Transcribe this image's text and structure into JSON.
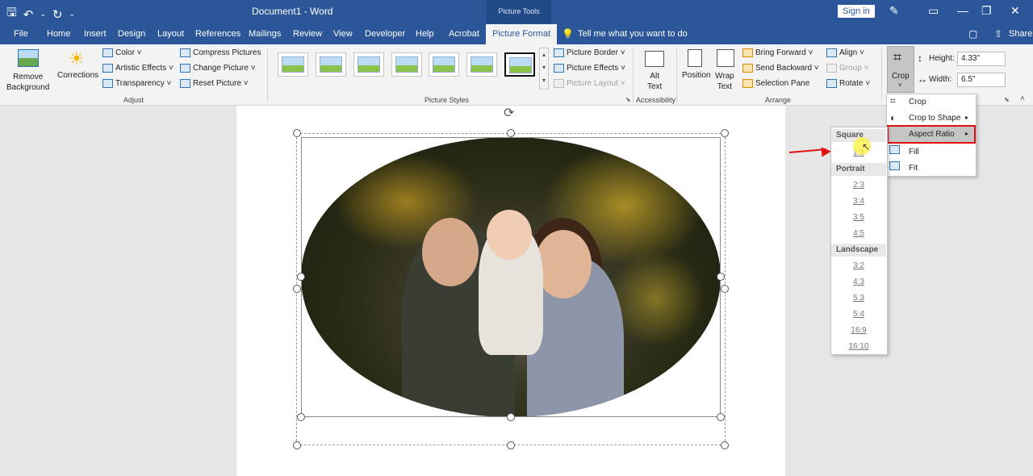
{
  "titlebar": {
    "doc_title": "Document1  -  Word",
    "context_label": "Picture Tools",
    "signin_label": "Sign in"
  },
  "tabs": [
    "File",
    "Home",
    "Insert",
    "Design",
    "Layout",
    "References",
    "Mailings",
    "Review",
    "View",
    "Developer",
    "Help",
    "Acrobat",
    "Picture Format"
  ],
  "tellme": "Tell me what you want to do",
  "share_label": "Share",
  "ribbon": {
    "remove_background": "Remove\nBackground",
    "corrections": "Corrections",
    "color": "Color",
    "artistic_effects": "Artistic Effects",
    "transparency": "Transparency",
    "compress_pictures": "Compress Pictures",
    "change_picture": "Change Picture",
    "reset_picture": "Reset Picture",
    "adjust_label": "Adjust",
    "picture_styles_label": "Picture Styles",
    "picture_border": "Picture Border",
    "picture_effects": "Picture Effects",
    "picture_layout": "Picture Layout",
    "alt_text": "Alt\nText",
    "accessibility_label": "Accessibility",
    "position": "Position",
    "wrap_text": "Wrap\nText",
    "bring_forward": "Bring Forward",
    "send_backward": "Send Backward",
    "selection_pane": "Selection Pane",
    "align": "Align",
    "group": "Group",
    "rotate": "Rotate",
    "arrange_label": "Arrange",
    "crop": "Crop",
    "height_label": "Height:",
    "height_value": "4.33\"",
    "width_label": "Width:",
    "width_value": "6.5\""
  },
  "crop_menu": {
    "items": [
      "Crop",
      "Crop to Shape",
      "Aspect Ratio",
      "Fill",
      "Fit"
    ]
  },
  "aspect_menu": {
    "square_header": "Square",
    "square": [
      "1:1"
    ],
    "portrait_header": "Portrait",
    "portrait": [
      "2:3",
      "3:4",
      "3:5",
      "4:5"
    ],
    "landscape_header": "Landscape",
    "landscape": [
      "3:2",
      "4:3",
      "5:3",
      "5:4",
      "16:9",
      "16:10"
    ]
  },
  "colors": {
    "brand": "#2b579a",
    "highlight": "#e01010"
  }
}
